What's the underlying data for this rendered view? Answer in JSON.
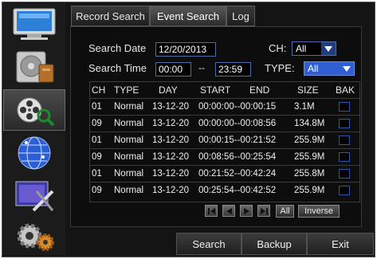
{
  "tabs": [
    {
      "label": "Record Search"
    },
    {
      "label": "Event Search",
      "active": true
    },
    {
      "label": "Log"
    }
  ],
  "sidebar": {
    "items": [
      {
        "icon": "monitor-icon"
      },
      {
        "icon": "hard-disk-icon"
      },
      {
        "icon": "film-reel-search-icon",
        "active": true
      },
      {
        "icon": "network-globe-icon"
      },
      {
        "icon": "screen-tools-icon"
      },
      {
        "icon": "gears-icon"
      }
    ]
  },
  "search": {
    "date_label": "Search Date",
    "date_value": "12/20/2013",
    "ch_label": "CH:",
    "ch_value": "All",
    "time_label": "Search Time",
    "time_start": "00:00",
    "time_sep": "--",
    "time_end": "23:59",
    "type_label": "TYPE:",
    "type_value": "All"
  },
  "table": {
    "headers": [
      "CH",
      "TYPE",
      "DAY",
      "START",
      "END",
      "SIZE",
      "BAK"
    ],
    "rows": [
      {
        "ch": "01",
        "type": "Normal",
        "day": "13-12-20",
        "time": "00:00:00--00:00:15",
        "size": "3.1M"
      },
      {
        "ch": "09",
        "type": "Normal",
        "day": "13-12-20",
        "time": "00:00:00--00:08:56",
        "size": "134.8M"
      },
      {
        "ch": "01",
        "type": "Normal",
        "day": "13-12-20",
        "time": "00:00:15--00:21:52",
        "size": "255.9M"
      },
      {
        "ch": "09",
        "type": "Normal",
        "day": "13-12-20",
        "time": "00:08:56--00:25:54",
        "size": "255.9M"
      },
      {
        "ch": "01",
        "type": "Normal",
        "day": "13-12-20",
        "time": "00:21:52--00:42:24",
        "size": "255.8M"
      },
      {
        "ch": "09",
        "type": "Normal",
        "day": "13-12-20",
        "time": "00:25:54--00:42:52",
        "size": "255.9M"
      }
    ]
  },
  "pager": {
    "all_label": "All",
    "inverse_label": "Inverse"
  },
  "footer": {
    "search_label": "Search",
    "backup_label": "Backup",
    "exit_label": "Exit"
  },
  "colors": {
    "field_border": "#4a6fa8",
    "type_select": "#2f5fd0",
    "checkbox_border": "#2a5ab0"
  }
}
